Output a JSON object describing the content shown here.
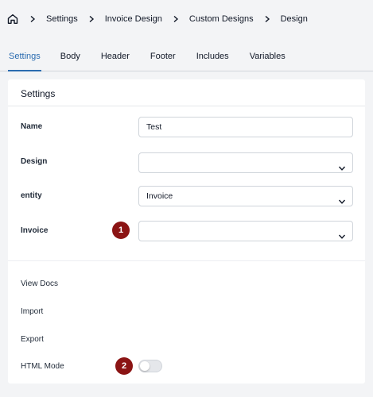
{
  "breadcrumb": {
    "items": [
      "Settings",
      "Invoice Design",
      "Custom Designs",
      "Design"
    ]
  },
  "tabs": [
    {
      "label": "Settings",
      "active": true
    },
    {
      "label": "Body",
      "active": false
    },
    {
      "label": "Header",
      "active": false
    },
    {
      "label": "Footer",
      "active": false
    },
    {
      "label": "Includes",
      "active": false
    },
    {
      "label": "Variables",
      "active": false
    }
  ],
  "card": {
    "title": "Settings",
    "fields": {
      "name": {
        "label": "Name",
        "value": "Test"
      },
      "design": {
        "label": "Design",
        "value": ""
      },
      "entity": {
        "label": "entity",
        "value": "Invoice"
      },
      "invoice": {
        "label": "Invoice",
        "value": "",
        "badge": "1"
      }
    },
    "links": {
      "view_docs": "View Docs",
      "import": "Import",
      "export": "Export"
    },
    "html_mode": {
      "label": "HTML Mode",
      "badge": "2",
      "enabled": false
    }
  },
  "colors": {
    "accent": "#2b6cb0",
    "badge": "#8b1414",
    "background": "#f3f4f6"
  }
}
